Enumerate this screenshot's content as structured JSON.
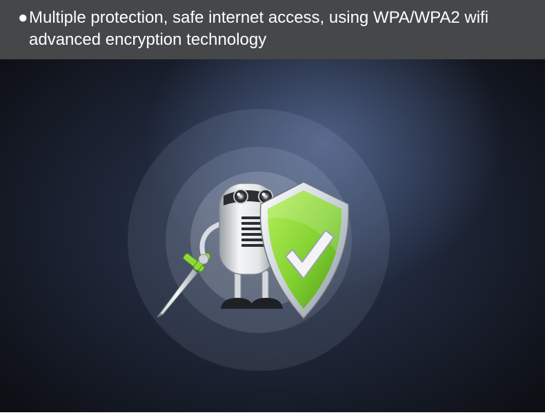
{
  "banner": {
    "bullet": "●",
    "line1": "Multiple protection, safe internet access, using WPA/WPA2 wifi",
    "line2": "advanced encryption technology"
  },
  "illustration": {
    "robot": "robot-icon",
    "shield": "shield-check-icon",
    "sword": "sword-icon",
    "colors": {
      "shield_green": "#8fd93a",
      "shield_rim": "#dfe6ec",
      "robot_body": "#e6e8ea",
      "background_dark": "#12151d",
      "background_glow": "#5a6f9a"
    }
  }
}
